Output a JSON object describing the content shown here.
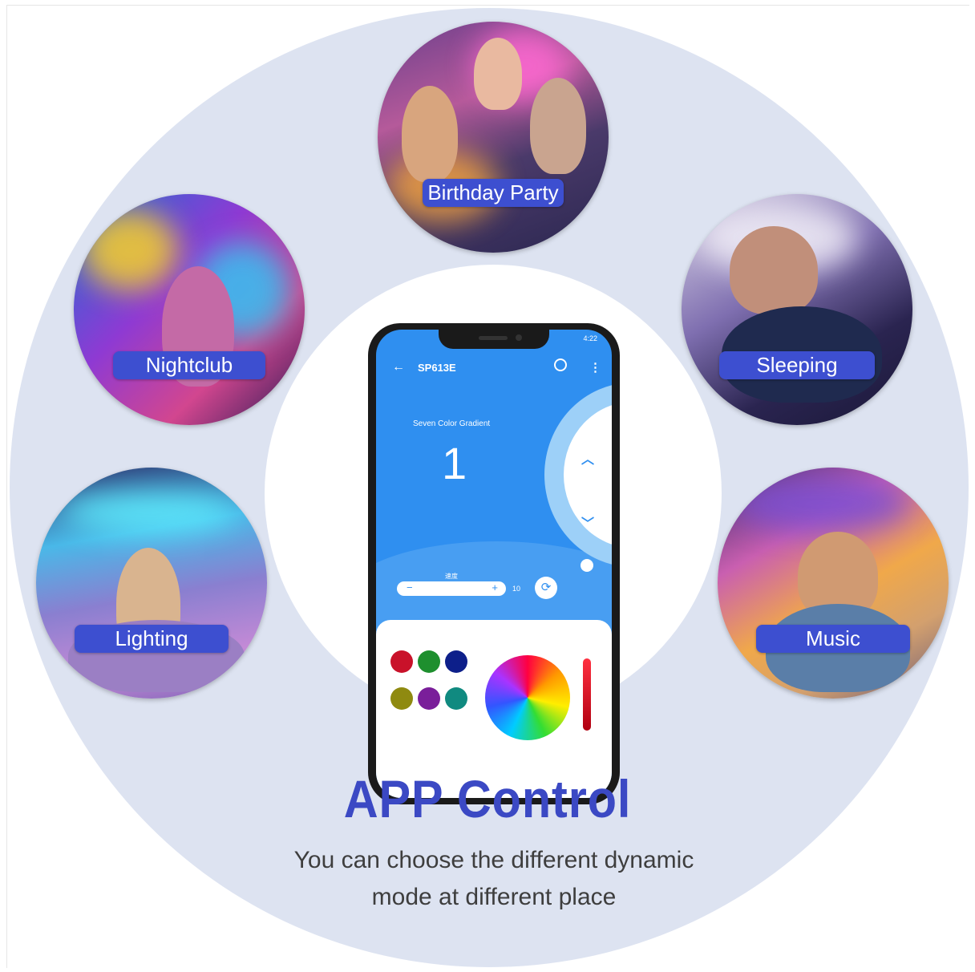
{
  "scenes": {
    "birthday": {
      "label": "Birthday Party"
    },
    "nightclub": {
      "label": "Nightclub"
    },
    "sleeping": {
      "label": "Sleeping"
    },
    "lighting": {
      "label": "Lighting"
    },
    "music": {
      "label": "Music"
    }
  },
  "phone": {
    "status_time": "4:22",
    "device_name": "SP613E",
    "mode_name": "Seven Color Gradient",
    "mode_number": "1",
    "speed_label": "速度",
    "speed_value": "10",
    "slider_minus": "−",
    "slider_plus": "+"
  },
  "icons": {
    "back": "back-arrow-icon",
    "alarm": "alarm-clock-icon",
    "menu": "more-vert-icon",
    "up": "chevron-up-icon",
    "down": "chevron-down-icon",
    "refresh": "refresh-icon"
  },
  "palette_colors": [
    "#c9122a",
    "#1e8f2e",
    "#0d1f8a",
    "#8f8a10",
    "#7a1e9a",
    "#108a80"
  ],
  "heading": {
    "title": "APP Control",
    "subtitle_line1": "You can choose the different dynamic",
    "subtitle_line2": "mode at different place"
  },
  "colors": {
    "accent": "#3b49c4",
    "label_bg": "#3d4fd0",
    "app_blue": "#2f8ff0",
    "background_circle": "#dde3f1"
  }
}
